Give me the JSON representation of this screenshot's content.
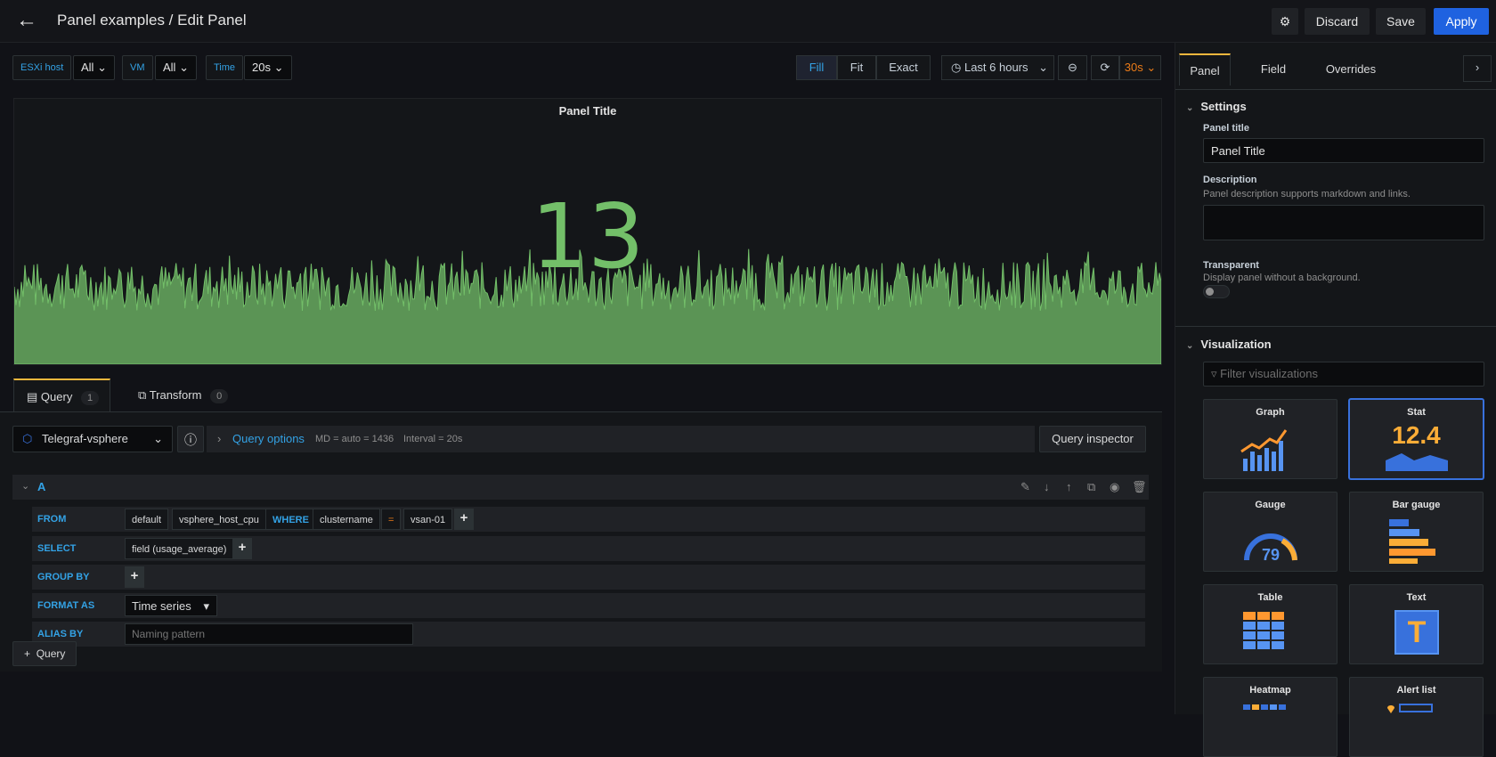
{
  "header": {
    "breadcrumb": "Panel examples / Edit Panel",
    "discard": "Discard",
    "save": "Save",
    "apply": "Apply"
  },
  "variables": [
    {
      "label": "ESXi host",
      "value": "All"
    },
    {
      "label": "VM",
      "value": "All"
    },
    {
      "label": "Time",
      "value": "20s"
    }
  ],
  "view_modes": [
    "Fill",
    "Fit",
    "Exact"
  ],
  "active_view_mode": "Fill",
  "time_range": "Last 6 hours",
  "refresh": "30s",
  "panel": {
    "title": "Panel Title",
    "value": "13",
    "color": "#73bf69"
  },
  "query_tabs": [
    {
      "label": "Query",
      "count": "1"
    },
    {
      "label": "Transform",
      "count": "0"
    }
  ],
  "query": {
    "datasource": "Telegraf-vsphere",
    "options_label": "Query options",
    "md": "MD = auto = 1436",
    "interval": "Interval = 20s",
    "inspector": "Query inspector",
    "ref": "A",
    "from_kw": "FROM",
    "from_db": "default",
    "from_measure": "vsphere_host_cpu",
    "where_kw": "WHERE",
    "where_key": "clustername",
    "where_op": "=",
    "where_val": "vsan-01",
    "select_kw": "SELECT",
    "select_field": "field (usage_average)",
    "group_kw": "GROUP BY",
    "format_kw": "FORMAT AS",
    "format_val": "Time series",
    "alias_kw": "ALIAS BY",
    "alias_placeholder": "Naming pattern",
    "add_query": "Query"
  },
  "options": {
    "tabs": [
      "Panel",
      "Field",
      "Overrides"
    ],
    "settings": "Settings",
    "panel_title_label": "Panel title",
    "panel_title_value": "Panel Title",
    "description_label": "Description",
    "description_help": "Panel description supports markdown and links.",
    "transparent_label": "Transparent",
    "transparent_help": "Display panel without a background.",
    "visualization": "Visualization",
    "filter_placeholder": "Filter visualizations",
    "visualizations": [
      "Graph",
      "Stat",
      "Gauge",
      "Bar gauge",
      "Table",
      "Text",
      "Heatmap",
      "Alert list"
    ],
    "selected": "Stat",
    "stat_preview": "12.4",
    "gauge_preview": "79",
    "text_preview": "T"
  }
}
